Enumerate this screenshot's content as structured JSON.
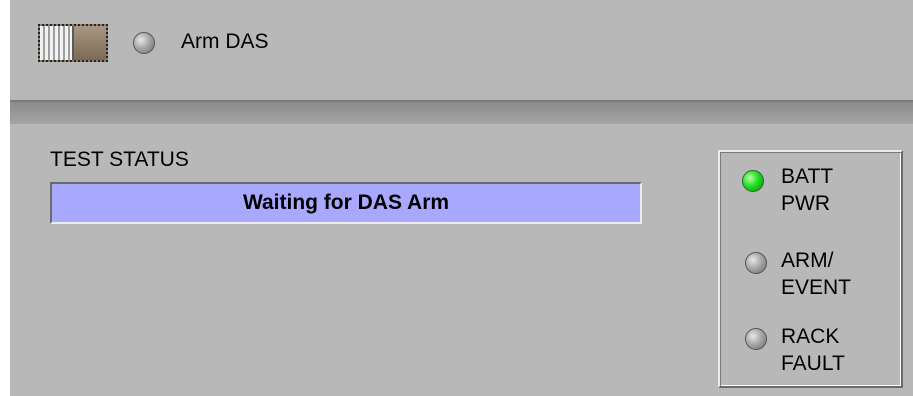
{
  "arm_control": {
    "label": "Arm DAS",
    "toggle_state": "off"
  },
  "test_status": {
    "heading": "TEST STATUS",
    "value": "Waiting for DAS Arm",
    "background_color": "#a8a8ff"
  },
  "indicators": [
    {
      "line1": "BATT",
      "line2": "PWR",
      "state": "on",
      "color": "#20e020"
    },
    {
      "line1": "ARM/",
      "line2": "EVENT",
      "state": "off",
      "color": "#a8a8a8"
    },
    {
      "line1": "RACK",
      "line2": "FAULT",
      "state": "off",
      "color": "#a8a8a8"
    }
  ]
}
